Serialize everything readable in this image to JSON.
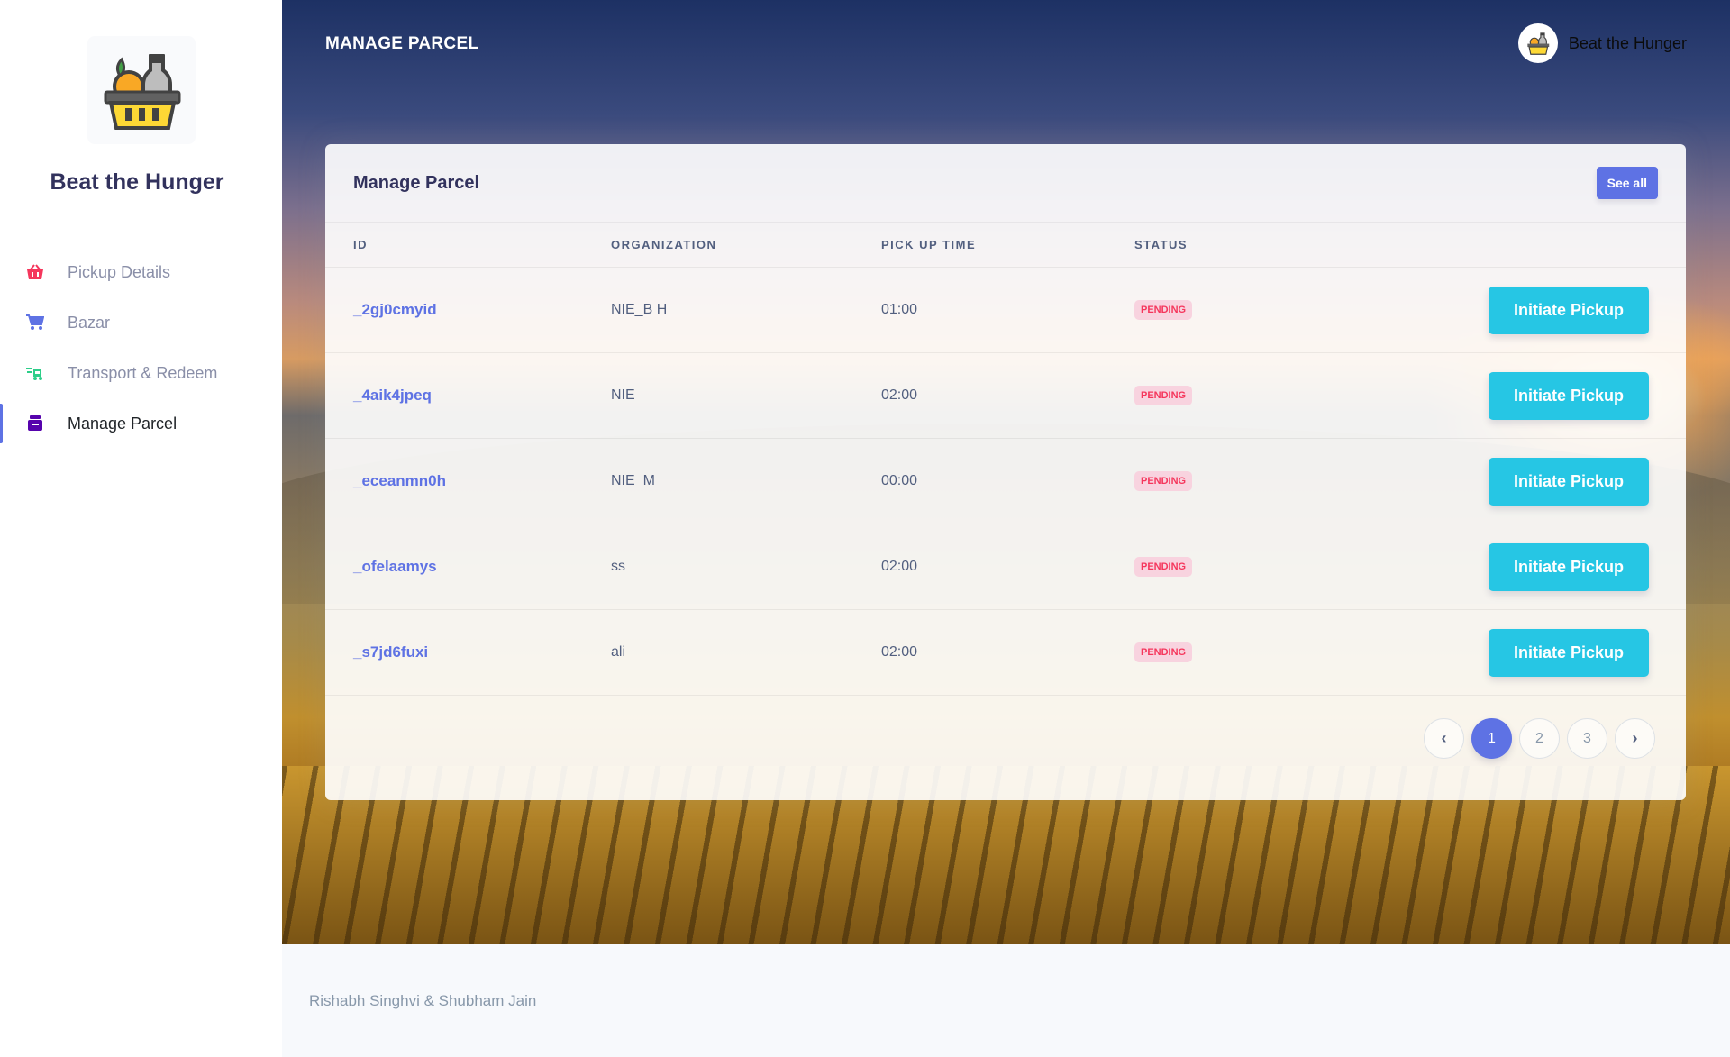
{
  "sidebar": {
    "brand": "Beat the Hunger",
    "items": [
      {
        "label": "Pickup Details",
        "icon": "basket-icon",
        "color": "#f5365c"
      },
      {
        "label": "Bazar",
        "icon": "cart-icon",
        "color": "#5e72e4"
      },
      {
        "label": "Transport & Redeem",
        "icon": "truck-money-icon",
        "color": "#2dce89"
      },
      {
        "label": "Manage Parcel",
        "icon": "parcel-icon",
        "color": "#5603ad",
        "active": true
      }
    ]
  },
  "header": {
    "page_title": "MANAGE PARCEL",
    "user_name": "Beat the Hunger"
  },
  "card": {
    "title": "Manage Parcel",
    "see_all_label": "See all",
    "columns": [
      "ID",
      "ORGANIZATION",
      "PICK UP TIME",
      "STATUS"
    ],
    "rows": [
      {
        "id": "_2gj0cmyid",
        "organization": "NIE_B H",
        "pickup_time": "01:00",
        "status": "PENDING",
        "action": "Initiate Pickup"
      },
      {
        "id": "_4aik4jpeq",
        "organization": "NIE",
        "pickup_time": "02:00",
        "status": "PENDING",
        "action": "Initiate Pickup"
      },
      {
        "id": "_eceanmn0h",
        "organization": "NIE_M",
        "pickup_time": "00:00",
        "status": "PENDING",
        "action": "Initiate Pickup"
      },
      {
        "id": "_ofelaamys",
        "organization": "ss",
        "pickup_time": "02:00",
        "status": "PENDING",
        "action": "Initiate Pickup"
      },
      {
        "id": "_s7jd6fuxi",
        "organization": "ali",
        "pickup_time": "02:00",
        "status": "PENDING",
        "action": "Initiate Pickup"
      }
    ],
    "pagination": {
      "prev": "‹",
      "pages": [
        "1",
        "2",
        "3"
      ],
      "current": "1",
      "next": "›"
    }
  },
  "footer": {
    "credits": "Rishabh Singhvi & Shubham Jain"
  },
  "colors": {
    "primary": "#5e72e4",
    "info": "#26c6e4",
    "danger": "#f5365c"
  }
}
